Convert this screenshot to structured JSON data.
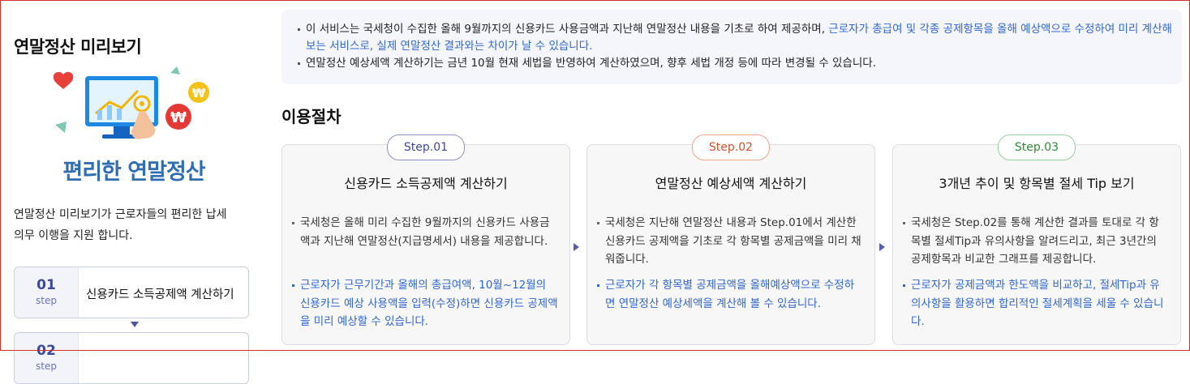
{
  "sidebar": {
    "title": "연말정산 미리보기",
    "subtitle": "편리한 연말정산",
    "desc_line1": "연말정산 미리보기가 근로자들의  편리한 납세",
    "desc_line2": "의무 이행을 지원 합니다.",
    "steps": [
      {
        "num": "01",
        "num_label": "step",
        "label": "신용카드 소득공제액 계산하기"
      },
      {
        "num": "02",
        "num_label": "step",
        "label": ""
      }
    ]
  },
  "notice": {
    "line1_plain": "이 서비스는 국세청이 수집한 올해 9월까지의 신용카드 사용금액과 지난해 연말정산 내용을 기초로 하여 제공하며, ",
    "line1_blue": "근로자가 총급여 및 각종 공제항목을 올해 예상액으로 수정하여 미리 계산해 보는 서비스로, 실제 연말정산 결과와는 차이가 날 수 있습니다.",
    "line2": "연말정산 예상세액 계산하기는 금년 10월 현재 세법을 반영하여 계산하였으며, 향후 세법 개정 등에 따라 변경될 수 있습니다."
  },
  "section_title": "이용절차",
  "steps": [
    {
      "pill": "Step.01",
      "title": "신용카드 소득공제액 계산하기",
      "text1": "국세청은 올해 미리 수집한 9월까지의 신용카드 사용금액과 지난해 연말정산(지급명세서) 내용을 제공합니다.",
      "text2": "근로자가 근무기간과 올해의 총급여액, 10월~12월의 신용카드 예상 사용액을 입력(수정)하면 신용카드 공제액을 미리 예상할 수 있습니다."
    },
    {
      "pill": "Step.02",
      "title": "연말정산 예상세액 계산하기",
      "text1": "국세청은 지난해 연말정산 내용과 Step.01에서 계산한 신용카드 공제액을 기초로 각 항목별 공제금액을 미리 채워줍니다.",
      "text2": "근로자가 각 항목별 공제금액을 올해예상액으로 수정하면 연말정산 예상세액을 계산해 볼 수 있습니다."
    },
    {
      "pill": "Step.03",
      "title": "3개년 추이 및 항목별 절세 Tip 보기",
      "text1": "국세청은 Step.02를 통해 계산한 결과를 토대로 각 항목별 절세Tip과 유의사항을 알려드리고, 최근 3년간의 공제항목과 비교한 그래프를 제공합니다.",
      "text2": "근로자가 공제금액과 한도액을 비교하고, 절세Tip과 유의사항을 활용하면 합리적인 절세계획을 세울 수 있습니다."
    }
  ],
  "colors": {
    "accent_blue": "#2f66d0",
    "subtitle_blue": "#2f6db5",
    "step1": "#3b4a9a",
    "step2": "#d4502a",
    "step3": "#2f8a35"
  }
}
